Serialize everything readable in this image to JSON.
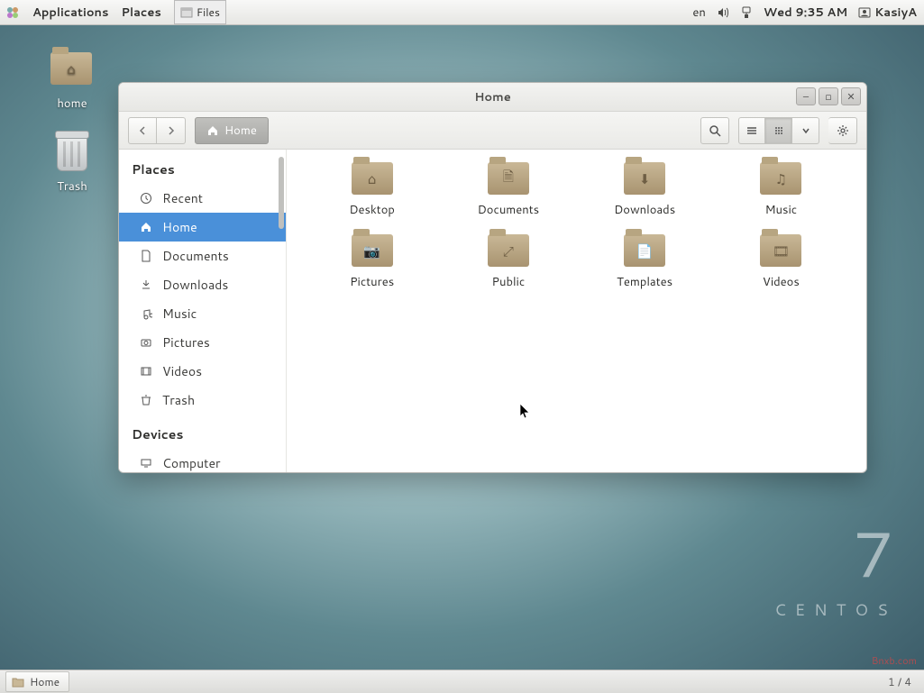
{
  "panel": {
    "apps": "Applications",
    "places": "Places",
    "current_app": "Files",
    "lang": "en",
    "clock": "Wed  9:35 AM",
    "user": "KasiyA"
  },
  "desktop": {
    "home": "home",
    "trash": "Trash"
  },
  "fm": {
    "title": "Home",
    "path_label": "Home",
    "sidebar": {
      "places_header": "Places",
      "devices_header": "Devices",
      "items": [
        {
          "label": "Recent"
        },
        {
          "label": "Home"
        },
        {
          "label": "Documents"
        },
        {
          "label": "Downloads"
        },
        {
          "label": "Music"
        },
        {
          "label": "Pictures"
        },
        {
          "label": "Videos"
        },
        {
          "label": "Trash"
        }
      ],
      "devices": [
        {
          "label": "Computer"
        }
      ]
    },
    "folders": [
      {
        "name": "Desktop",
        "glyph": "⌂"
      },
      {
        "name": "Documents",
        "glyph": "🗎"
      },
      {
        "name": "Downloads",
        "glyph": "⬇"
      },
      {
        "name": "Music",
        "glyph": "♫"
      },
      {
        "name": "Pictures",
        "glyph": "📷"
      },
      {
        "name": "Public",
        "glyph": "⤢"
      },
      {
        "name": "Templates",
        "glyph": "📄"
      },
      {
        "name": "Videos",
        "glyph": "🎞"
      }
    ]
  },
  "brand": {
    "version": "7",
    "name": "CENTOS"
  },
  "taskbar": {
    "window": "Home",
    "pager": "1 / 4"
  },
  "watermark": "Bnxb.com"
}
